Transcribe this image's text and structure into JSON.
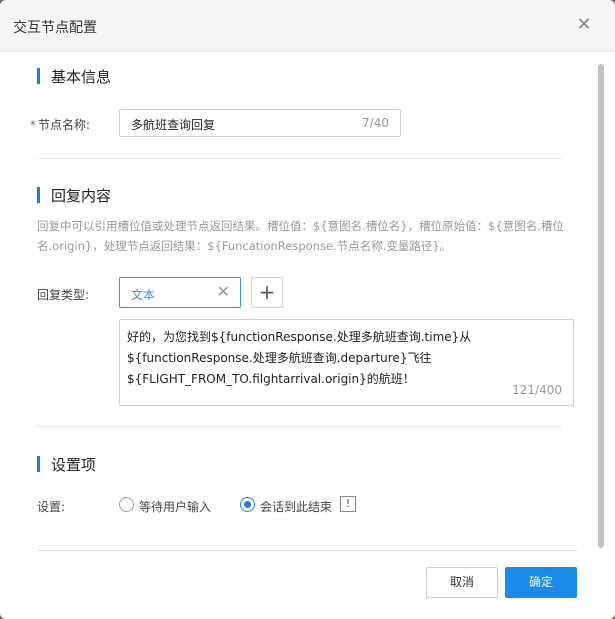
{
  "dialog": {
    "title": "交互节点配置",
    "close_icon": "close-icon"
  },
  "basic_info": {
    "section_title": "基本信息",
    "required_mark": "*",
    "name_label": "节点名称:",
    "name_value": "多航班查询回复",
    "name_count": "7/40"
  },
  "reply": {
    "section_title": "回复内容",
    "hint": "回复中可以引用槽位值或处理节点返回结果。槽位值：${意图名.槽位名}，槽位原始值：${意图名.槽位名.origin}，处理节点返回结果：${FuncationResponse.节点名称.变量路径}。",
    "type_label": "回复类型:",
    "type_value": "文本",
    "clear_icon": "clear-icon",
    "add_icon": "plus-icon",
    "text_line1": "好的，为您找到${functionResponse.处理多航班查询.time}从",
    "text_line2": "${functionResponse.处理多航班查询.departure}飞往",
    "text_line3": "${FLIGHT_FROM_TO.filghtarrival.origin}的航班！",
    "text_count": "121/400"
  },
  "settings": {
    "section_title": "设置项",
    "label": "设置:",
    "option_wait": "等待用户输入",
    "option_end": "会话到此结束",
    "selected": "会话到此结束",
    "info_icon": "!"
  },
  "footer": {
    "cancel_label": "取消",
    "ok_label": "确定"
  },
  "colors": {
    "accent": "#1e7fd6",
    "primary_button": "#1a8be6",
    "required": "#e54545"
  }
}
